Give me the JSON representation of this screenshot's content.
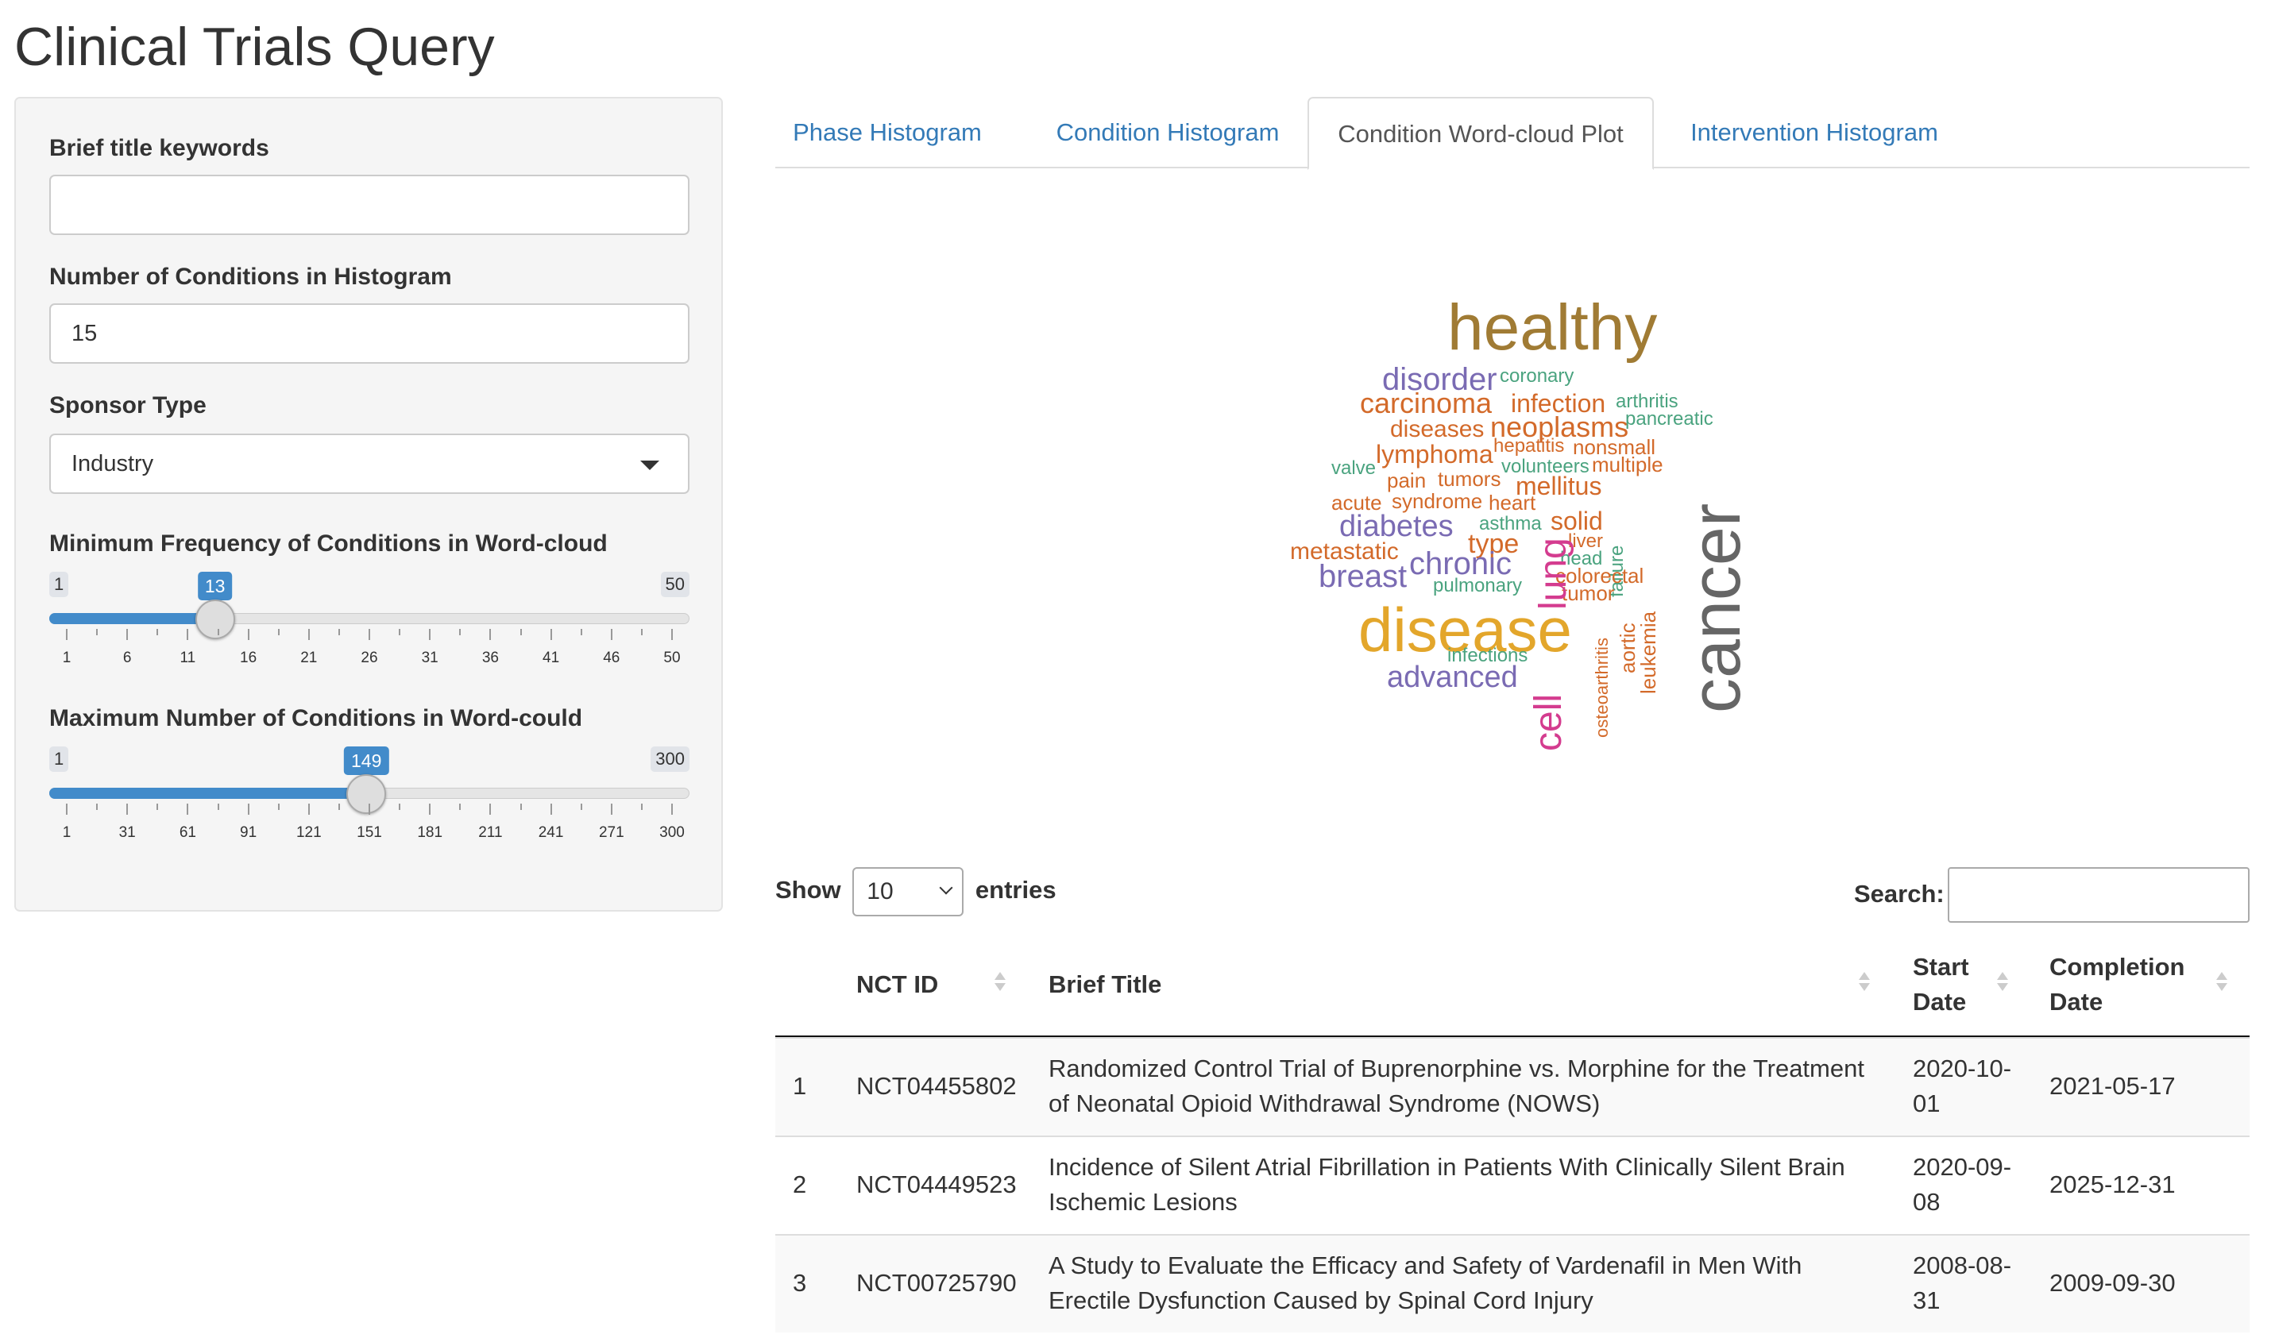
{
  "page": {
    "title": "Clinical Trials Query"
  },
  "sidebar": {
    "keywords": {
      "label": "Brief title keywords",
      "value": ""
    },
    "num_conditions": {
      "label": "Number of Conditions in Histogram",
      "value": "15"
    },
    "sponsor": {
      "label": "Sponsor Type",
      "value": "Industry"
    },
    "min_freq": {
      "label": "Minimum Frequency of Conditions in Word-cloud",
      "min": "1",
      "max": "50",
      "value": "13",
      "ticks": [
        "1",
        "6",
        "11",
        "16",
        "21",
        "26",
        "31",
        "36",
        "41",
        "46",
        "50"
      ]
    },
    "max_words": {
      "label": "Maximum Number of Conditions in Word-could",
      "min": "1",
      "max": "300",
      "value": "149",
      "ticks": [
        "1",
        "31",
        "61",
        "91",
        "121",
        "151",
        "181",
        "211",
        "241",
        "271",
        "300"
      ]
    }
  },
  "tabs": [
    {
      "label": "Phase Histogram",
      "active": false
    },
    {
      "label": "Condition Histogram",
      "active": false
    },
    {
      "label": "Condition Word-cloud Plot",
      "active": true
    },
    {
      "label": "Intervention Histogram",
      "active": false
    }
  ],
  "wordcloud": [
    {
      "text": "healthy",
      "color": "#a07b34"
    },
    {
      "text": "disorder",
      "color": "#7a6bb3"
    },
    {
      "text": "coronary",
      "color": "#4aa37f"
    },
    {
      "text": "carcinoma",
      "color": "#d36a2a"
    },
    {
      "text": "infection",
      "color": "#d36a2a"
    },
    {
      "text": "arthritis",
      "color": "#4aa37f"
    },
    {
      "text": "diseases",
      "color": "#d36a2a"
    },
    {
      "text": "neoplasms",
      "color": "#d36a2a"
    },
    {
      "text": "pancreatic",
      "color": "#4aa37f"
    },
    {
      "text": "lymphoma",
      "color": "#d36a2a"
    },
    {
      "text": "hepatitis",
      "color": "#d36a2a"
    },
    {
      "text": "nonsmall",
      "color": "#d36a2a"
    },
    {
      "text": "valve",
      "color": "#4aa37f"
    },
    {
      "text": "volunteers",
      "color": "#4aa37f"
    },
    {
      "text": "multiple",
      "color": "#d36a2a"
    },
    {
      "text": "pain",
      "color": "#d36a2a"
    },
    {
      "text": "tumors",
      "color": "#d36a2a"
    },
    {
      "text": "mellitus",
      "color": "#d36a2a"
    },
    {
      "text": "acute",
      "color": "#d36a2a"
    },
    {
      "text": "syndrome",
      "color": "#d36a2a"
    },
    {
      "text": "heart",
      "color": "#d36a2a"
    },
    {
      "text": "diabetes",
      "color": "#7a6bb3"
    },
    {
      "text": "asthma",
      "color": "#4aa37f"
    },
    {
      "text": "solid",
      "color": "#d36a2a"
    },
    {
      "text": "type",
      "color": "#d36a2a"
    },
    {
      "text": "liver",
      "color": "#d36a2a"
    },
    {
      "text": "failure",
      "color": "#4aa37f"
    },
    {
      "text": "metastatic",
      "color": "#d36a2a"
    },
    {
      "text": "chronic",
      "color": "#7a6bb3"
    },
    {
      "text": "head",
      "color": "#4aa37f"
    },
    {
      "text": "colorectal",
      "color": "#d36a2a"
    },
    {
      "text": "breast",
      "color": "#7a6bb3"
    },
    {
      "text": "pulmonary",
      "color": "#4aa37f"
    },
    {
      "text": "tumor",
      "color": "#d36a2a"
    },
    {
      "text": "lung",
      "color": "#d43c8f"
    },
    {
      "text": "disease",
      "color": "#e3a62b"
    },
    {
      "text": "osteoarthritis",
      "color": "#d36a2a"
    },
    {
      "text": "aortic",
      "color": "#d36a2a"
    },
    {
      "text": "leukemia",
      "color": "#d36a2a"
    },
    {
      "text": "infections",
      "color": "#4aa37f"
    },
    {
      "text": "advanced",
      "color": "#7a6bb3"
    },
    {
      "text": "cell",
      "color": "#d43c8f"
    },
    {
      "text": "cancer",
      "color": "#666666"
    }
  ],
  "datatable": {
    "show_label": "Show",
    "entries_value": "10",
    "entries_label": "entries",
    "search_label": "Search:",
    "columns": [
      "",
      "NCT ID",
      "Brief Title",
      "Start Date",
      "Completion Date"
    ],
    "rows": [
      {
        "index": "1",
        "nct_id": "NCT04455802",
        "title_line1": "Randomized Control Trial of Buprenorphine vs. Morphine for the Treatment",
        "title_line2": "of Neonatal Opioid Withdrawal Syndrome (NOWS)",
        "start_line1": "2020-10-",
        "start_line2": "01",
        "completion": "2021-05-17"
      },
      {
        "index": "2",
        "nct_id": "NCT04449523",
        "title_line1": "Incidence of Silent Atrial Fibrillation in Patients With Clinically Silent Brain",
        "title_line2": "Ischemic Lesions",
        "start_line1": "2020-09-",
        "start_line2": "08",
        "completion": "2025-12-31"
      },
      {
        "index": "3",
        "nct_id": "NCT00725790",
        "title_line1": "A Study to Evaluate the Efficacy and Safety of Vardenafil in Men With",
        "title_line2": "Erectile Dysfunction Caused by Spinal Cord Injury",
        "start_line1": "2008-08-",
        "start_line2": "31",
        "completion": "2009-09-30"
      }
    ]
  }
}
